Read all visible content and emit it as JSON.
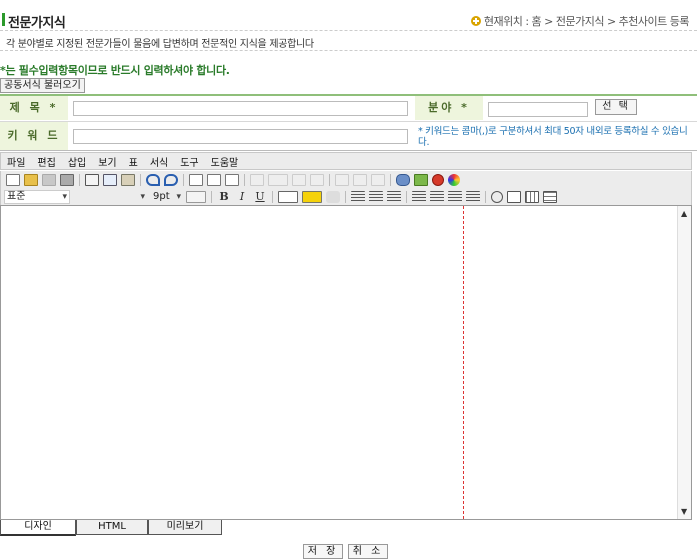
{
  "header": {
    "page_title": "전문가지식",
    "breadcrumb": "현재위치 : 홈 > 전문가지식 > 추천사이트 등록",
    "description": "각 분야별로 지정된 전문가들이 물음에 답변하며 전문적인 지식을 제공합니다"
  },
  "form": {
    "required_note": "*는 필수입력항목이므로 반드시 입력하셔야 합니다.",
    "load_template_button": "공동서식 불러오기",
    "title_label": "제 목 *",
    "title_value": "",
    "field_label": "분야 *",
    "field_value": "",
    "select_button": "선 택",
    "keyword_label": "키 워 드",
    "keyword_value": "",
    "keyword_hint": "* 키워드는 콤마(,)로 구분하셔서 최대 50자 내외로 등록하실 수 있습니다."
  },
  "editor": {
    "menu": [
      "파일",
      "편집",
      "삽입",
      "보기",
      "표",
      "서식",
      "도구",
      "도움말"
    ],
    "style_select": "표준",
    "font_select": "",
    "size_select": "9pt",
    "tabs": [
      "디자인",
      "HTML",
      "미리보기"
    ],
    "active_tab": "디자인"
  },
  "footer": {
    "save_button": "저 장",
    "cancel_button": "취 소"
  },
  "colors": {
    "accent_green": "#2c9a2c",
    "label_bg": "#eef5dd",
    "hint_blue": "#1a6fb0"
  }
}
